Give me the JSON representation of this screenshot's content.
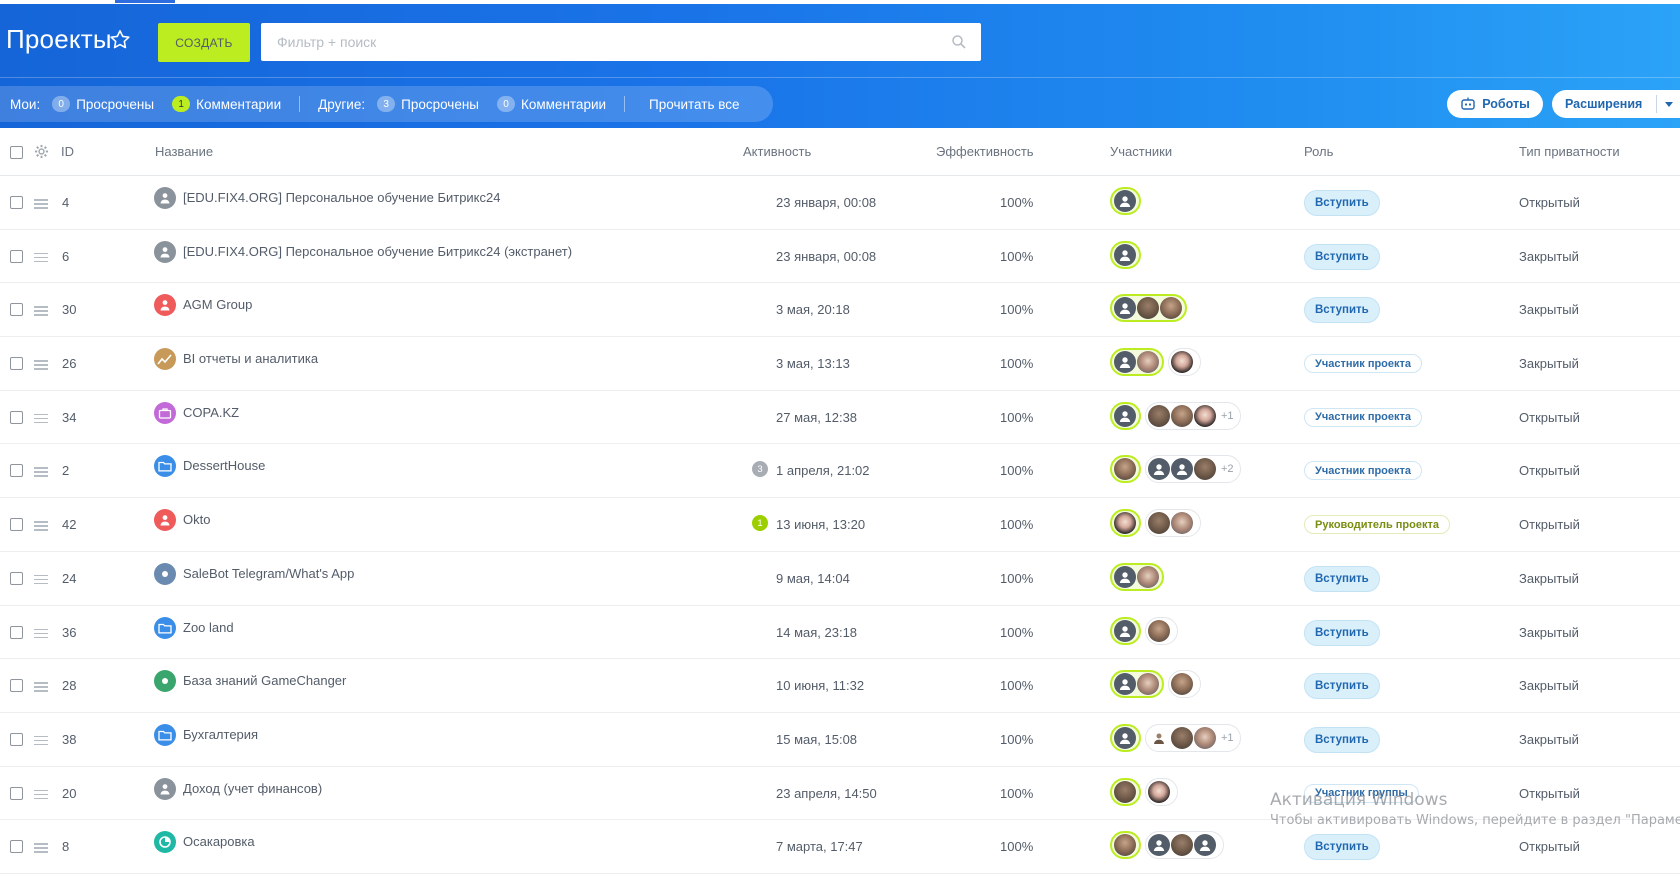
{
  "header": {
    "title": "Проекты",
    "create_label": "Создать",
    "search_placeholder": "Фильтр + поиск",
    "robots_label": "Роботы",
    "extensions_label": "Расширения"
  },
  "counters": {
    "my_label": "Мои:",
    "my_overdue_count": "0",
    "my_overdue_label": "Просрочены",
    "my_comments_count": "1",
    "my_comments_label": "Комментарии",
    "others_label": "Другие:",
    "others_overdue_count": "3",
    "others_overdue_label": "Просрочены",
    "others_comments_count": "0",
    "others_comments_label": "Комментарии",
    "read_all_label": "Прочитать все"
  },
  "columns": {
    "id": "ID",
    "name": "Название",
    "activity": "Активность",
    "efficiency": "Эффективность",
    "members": "Участники",
    "role": "Роль",
    "privacy": "Тип приватности"
  },
  "rows": [
    {
      "id": "4",
      "name": "[EDU.FIX4.ORG] Персональное обучение Битрикс24",
      "activity": "23 января, 00:08",
      "efficiency": "100%",
      "role": "Вступить",
      "privacy": "Открытый"
    },
    {
      "id": "6",
      "name": "[EDU.FIX4.ORG] Персональное обучение Битрикс24 (экстранет)",
      "activity": "23 января, 00:08",
      "efficiency": "100%",
      "role": "Вступить",
      "privacy": "Закрытый"
    },
    {
      "id": "30",
      "name": "AGM Group",
      "activity": "3 мая, 20:18",
      "efficiency": "100%",
      "role": "Вступить",
      "privacy": "Закрытый"
    },
    {
      "id": "26",
      "name": "BI отчеты и аналитика",
      "activity": "3 мая, 13:13",
      "efficiency": "100%",
      "role": "Участник проекта",
      "privacy": "Закрытый"
    },
    {
      "id": "34",
      "name": "COPA.KZ",
      "activity": "27 мая, 12:38",
      "efficiency": "100%",
      "role": "Участник проекта",
      "privacy": "Открытый",
      "members_extra": "+1"
    },
    {
      "id": "2",
      "name": "DessertHouse",
      "activity": "1 апреля, 21:02",
      "activity_badge": "3",
      "efficiency": "100%",
      "role": "Участник проекта",
      "privacy": "Открытый",
      "members_extra": "+2"
    },
    {
      "id": "42",
      "name": "Okto",
      "activity": "13 июня, 13:20",
      "activity_badge": "1",
      "efficiency": "100%",
      "role": "Руководитель проекта",
      "privacy": "Открытый"
    },
    {
      "id": "24",
      "name": "SaleBot Telegram/What's App",
      "activity": "9 мая, 14:04",
      "efficiency": "100%",
      "role": "Вступить",
      "privacy": "Закрытый"
    },
    {
      "id": "36",
      "name": "Zoo land",
      "activity": "14 мая, 23:18",
      "efficiency": "100%",
      "role": "Вступить",
      "privacy": "Закрытый"
    },
    {
      "id": "28",
      "name": "База знаний GameChanger",
      "activity": "10 июня, 11:32",
      "efficiency": "100%",
      "role": "Вступить",
      "privacy": "Закрытый"
    },
    {
      "id": "38",
      "name": "Бухгалтерия",
      "activity": "15 мая, 15:08",
      "efficiency": "100%",
      "role": "Вступить",
      "privacy": "Закрытый",
      "members_extra": "+1"
    },
    {
      "id": "20",
      "name": "Доход (учет финансов)",
      "activity": "23 апреля, 14:50",
      "efficiency": "100%",
      "role": "Участник группы",
      "privacy": "Открытый"
    },
    {
      "id": "8",
      "name": "Осакаровка",
      "activity": "7 марта, 17:47",
      "efficiency": "100%",
      "role": "Вступить",
      "privacy": "Открытый"
    }
  ],
  "watermark": {
    "title": "Активация Windows",
    "subtitle": "Чтобы активировать Windows, перейдите в раздел \"Парамет"
  },
  "colors": {
    "header_blue": "#1a73e8",
    "create_green": "#bbed21",
    "join_pill": "#d9f0fb"
  }
}
